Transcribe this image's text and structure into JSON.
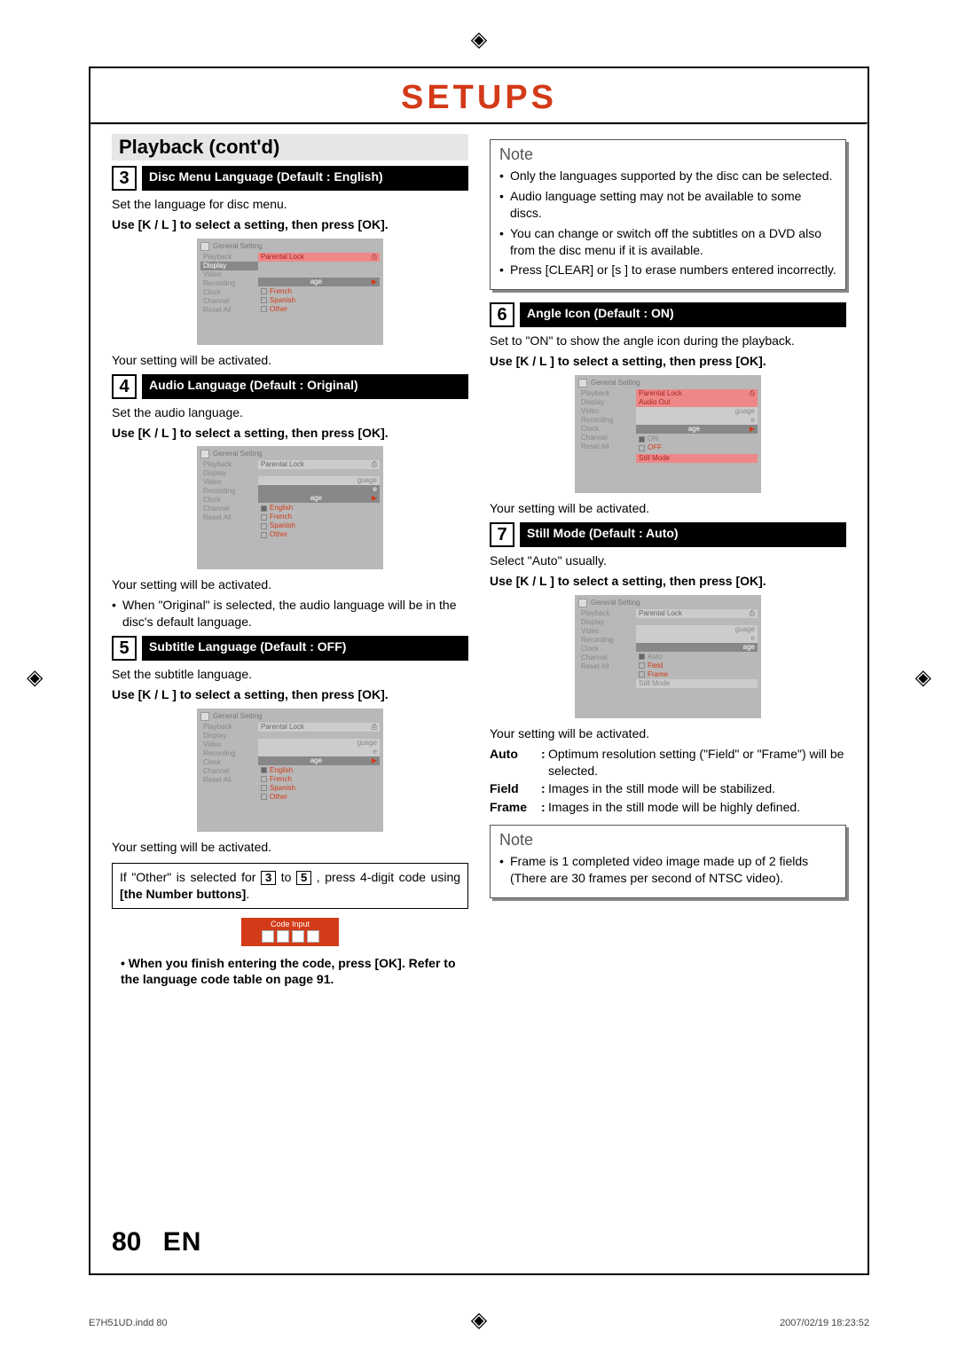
{
  "header": {
    "title": "SETUPS"
  },
  "section": {
    "title": "Playback (cont'd)"
  },
  "steps": {
    "s3": {
      "num": "3",
      "label": "Disc Menu Language (Default : English)",
      "intro": "Set the language for disc menu.",
      "instruction": "Use [K / L ] to select a setting, then press [OK].",
      "after": "Your setting will be activated."
    },
    "s4": {
      "num": "4",
      "label": "Audio Language (Default : Original)",
      "intro": "Set the audio language.",
      "instruction": "Use [K / L ] to select a setting, then press [OK].",
      "after": "Your setting will be activated.",
      "note": "When \"Original\" is selected, the audio language will be in the disc's default language."
    },
    "s5": {
      "num": "5",
      "label": "Subtitle Language (Default : OFF)",
      "intro": "Set the subtitle language.",
      "instruction": "Use [K / L ] to select a setting, then press [OK].",
      "after": "Your setting will be activated."
    },
    "code_hint_a": "If \"Other\" is selected for ",
    "code_hint_b": " to ",
    "code_hint_c": ", press 4-digit code using ",
    "code_hint_d": "[the Number buttons]",
    "code_hint_e": ".",
    "code_label": "Code Input",
    "code_after": "• When you finish entering the code, press [OK]. Refer to the language code table on page 91.",
    "s6": {
      "num": "6",
      "label": "Angle Icon (Default : ON)",
      "intro": "Set to \"ON\" to show the angle icon during the playback.",
      "instruction": "Use [K / L ] to select a setting, then press [OK].",
      "after": "Your setting will be activated."
    },
    "s7": {
      "num": "7",
      "label": "Still Mode (Default : Auto)",
      "intro": "Select \"Auto\" usually.",
      "instruction": "Use [K / L ] to select a setting, then press [OK].",
      "after": "Your setting will be activated.",
      "defs": {
        "auto": {
          "t": "Auto",
          "d": "Optimum resolution setting (\"Field\" or \"Frame\") will be selected."
        },
        "field": {
          "t": "Field",
          "d": "Images in the still mode will be stabilized."
        },
        "frame": {
          "t": "Frame",
          "d": "Images in the still mode will be highly defined."
        }
      }
    }
  },
  "notes": {
    "top": {
      "title": "Note",
      "items": [
        "Only the languages supported by the disc can be selected.",
        "Audio language setting may not be available to some discs.",
        "You can change or switch off the subtitles on a DVD also from the disc menu if it is available.",
        "Press [CLEAR] or [s ] to erase numbers entered incorrectly."
      ]
    },
    "bottom": {
      "title": "Note",
      "items": [
        "Frame is 1 completed video image made up of 2 fields (There are 30 frames per second of NTSC video)."
      ]
    }
  },
  "osd": {
    "title": "General Setting",
    "left": [
      "Playback",
      "Display",
      "Video",
      "Recording",
      "Clock",
      "Channel",
      "Reset All"
    ],
    "parental": "Parental Lock",
    "audio_out": "Audio Out",
    "lang_suffix1": "guage",
    "lang_suffix2": "age",
    "lang_suffix3": "e",
    "opts3": [
      "French",
      "Spanish",
      "Other"
    ],
    "opts4": [
      "English",
      "French",
      "Spanish",
      "Other"
    ],
    "opts5": [
      "English",
      "French",
      "Spanish",
      "Other"
    ],
    "opts6": [
      "ON",
      "OFF"
    ],
    "opts7": [
      "Auto",
      "Field",
      "Frame"
    ],
    "still_mode": "Still Mode"
  },
  "footer": {
    "page": "80",
    "lang": "EN"
  },
  "printfooter": {
    "left": "E7H51UD.indd   80",
    "right": "2007/02/19   18:23:52"
  }
}
